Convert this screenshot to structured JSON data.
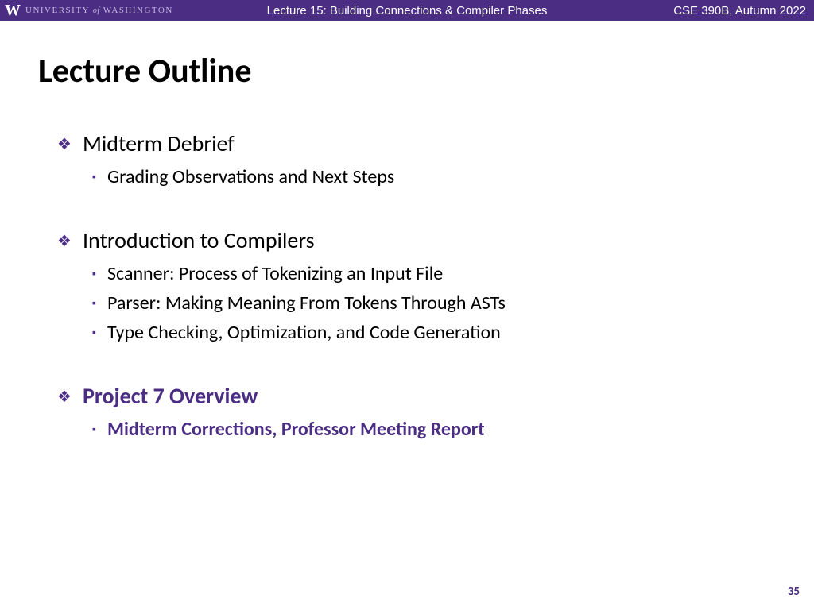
{
  "header": {
    "university_name_1": "UNIVERSITY",
    "university_of": "of",
    "university_name_2": "WASHINGTON",
    "lecture_title": "Lecture 15: Building Connections & Compiler Phases",
    "course_info": "CSE 390B, Autumn 2022"
  },
  "slide": {
    "title": "Lecture Outline",
    "sections": [
      {
        "heading": "Midterm Debrief",
        "items": [
          "Grading Observations and Next Steps"
        ],
        "highlighted": false
      },
      {
        "heading": "Introduction to Compilers",
        "items": [
          "Scanner: Process of Tokenizing an Input File",
          "Parser: Making Meaning From Tokens Through ASTs",
          "Type Checking, Optimization, and Code Generation"
        ],
        "highlighted": false
      },
      {
        "heading": "Project 7 Overview",
        "items": [
          "Midterm Corrections, Professor Meeting Report"
        ],
        "highlighted": true
      }
    ],
    "page_number": "35"
  },
  "colors": {
    "uw_purple": "#4b2e83"
  }
}
